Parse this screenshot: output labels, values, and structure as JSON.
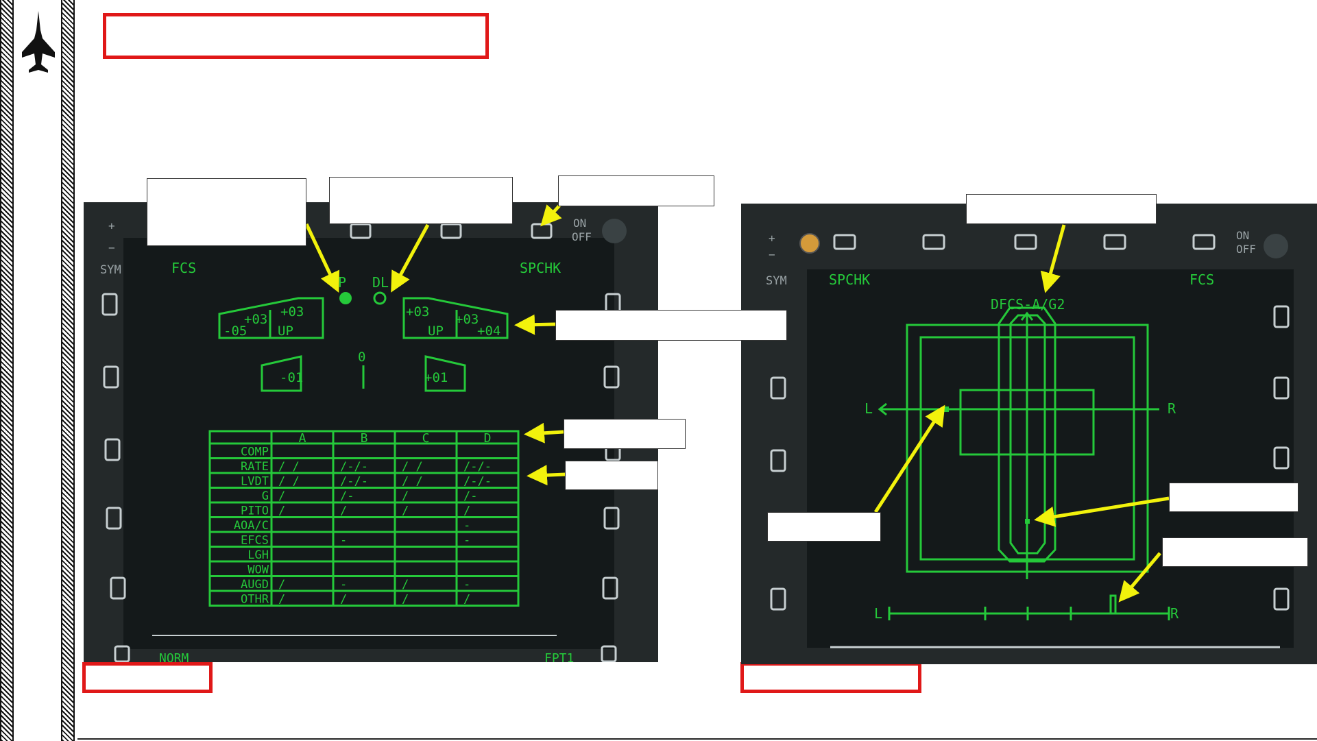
{
  "colors": {
    "accent_red": "#e01818",
    "mfd_green": "#25c93a",
    "arrow_yellow": "#f2f20c",
    "bezel": "#24292a",
    "screen": "#14191a"
  },
  "sidebar": {
    "icon": "fighter-jet-icon"
  },
  "left_mfd": {
    "bezel": {
      "plus": "+",
      "minus": "−",
      "sym": "SYM",
      "on": "ON",
      "off": "OFF"
    },
    "top_left": "FCS",
    "top_right": "SPCHK",
    "p": "P",
    "dl": "DL",
    "left_flap": {
      "a": "+03",
      "b": "+03",
      "c": "-05",
      "d": "UP"
    },
    "right_flap": {
      "a": "+03",
      "b": "+03",
      "c": "UP",
      "d": "+04"
    },
    "ail_left": "-01",
    "ail_right": "+01",
    "rudder_zero": "0",
    "table": {
      "columns": [
        "A",
        "B",
        "C",
        "D"
      ],
      "rows": [
        {
          "label": "COMP",
          "cells": [
            "",
            "",
            "",
            ""
          ]
        },
        {
          "label": "RATE",
          "cells": [
            "/ /",
            "/-/-",
            "/ /",
            "/-/-"
          ]
        },
        {
          "label": "LVDT",
          "cells": [
            "/ /",
            "/-/-",
            "/ /",
            "/-/-"
          ]
        },
        {
          "label": "G",
          "cells": [
            "/",
            "/-",
            "/",
            "/-"
          ]
        },
        {
          "label": "PITO",
          "cells": [
            "/",
            "/",
            "/",
            "/"
          ]
        },
        {
          "label": "AOA/C",
          "cells": [
            "",
            "",
            "",
            "-"
          ]
        },
        {
          "label": "EFCS",
          "cells": [
            "",
            "-",
            "",
            "-"
          ]
        },
        {
          "label": "LGH",
          "cells": [
            "",
            "",
            "",
            ""
          ]
        },
        {
          "label": "WOW",
          "cells": [
            "",
            "",
            "",
            ""
          ]
        },
        {
          "label": "AUGD",
          "cells": [
            "/",
            "-",
            "/",
            "-"
          ]
        },
        {
          "label": "OTHR",
          "cells": [
            "/",
            "/",
            "/",
            "/"
          ]
        }
      ]
    },
    "bottom_left": "NORM",
    "bottom_right": "FPT1"
  },
  "right_mfd": {
    "bezel": {
      "plus": "+",
      "minus": "−",
      "sym": "SYM",
      "on": "ON",
      "off": "OFF"
    },
    "top_left": "SPCHK",
    "top_right": "FCS",
    "title": "DFCS-A/G2",
    "left_label": "L",
    "right_label": "R",
    "scale_left": "L",
    "scale_right": "R"
  }
}
